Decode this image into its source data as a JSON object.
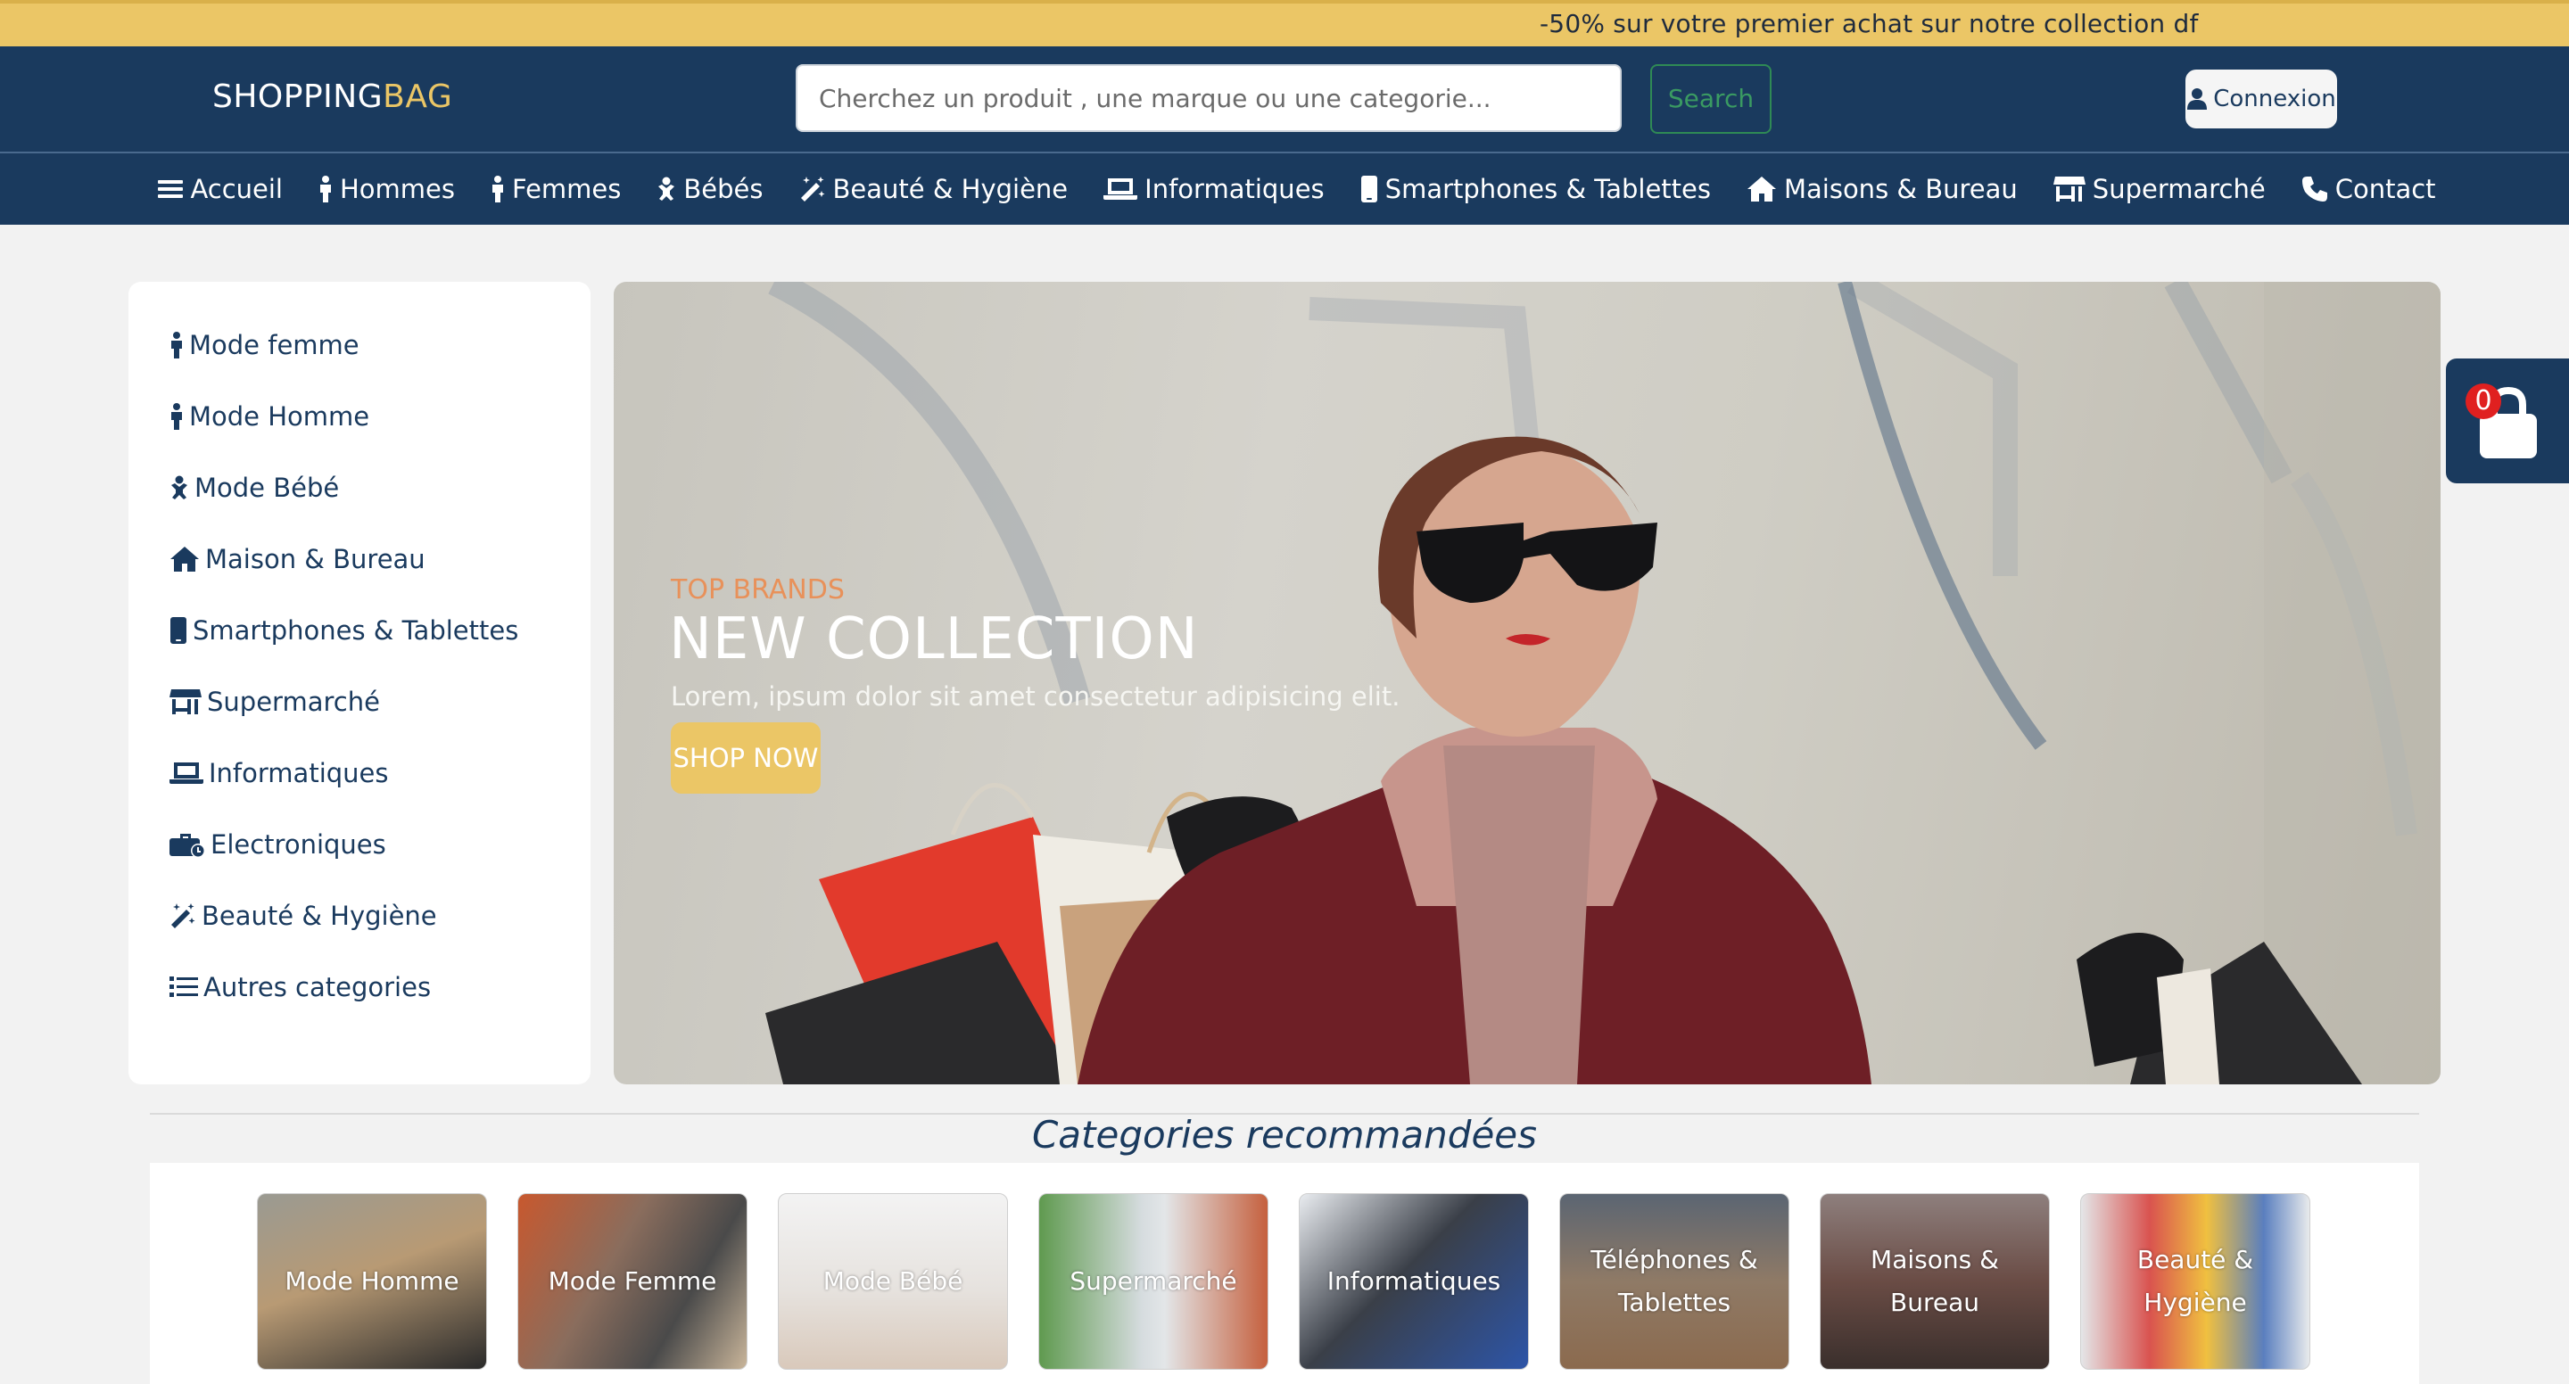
{
  "promo": {
    "text": "-50% sur votre premier achat sur notre collection df"
  },
  "header": {
    "brand_part1": "SHOPPING",
    "brand_part2": "BAG",
    "search_placeholder": "Cherchez un produit , une marque ou une categorie...",
    "search_button": "Search",
    "login_button": "Connexion"
  },
  "nav": {
    "items": [
      {
        "label": "Accueil",
        "icon": "bars-icon"
      },
      {
        "label": "Hommes",
        "icon": "person-icon"
      },
      {
        "label": "Femmes",
        "icon": "person-icon"
      },
      {
        "label": "Bébés",
        "icon": "baby-icon"
      },
      {
        "label": "Beauté & Hygiène",
        "icon": "magic-wand-icon"
      },
      {
        "label": "Informatiques",
        "icon": "laptop-icon"
      },
      {
        "label": "Smartphones & Tablettes",
        "icon": "mobile-icon"
      },
      {
        "label": "Maisons & Bureau",
        "icon": "house-icon"
      },
      {
        "label": "Supermarché",
        "icon": "store-icon"
      },
      {
        "label": "Contact",
        "icon": "phone-icon"
      }
    ]
  },
  "sidebar": {
    "items": [
      {
        "label": "Mode femme",
        "icon": "person-icon"
      },
      {
        "label": "Mode Homme",
        "icon": "person-icon"
      },
      {
        "label": "Mode Bébé",
        "icon": "baby-icon"
      },
      {
        "label": "Maison & Bureau",
        "icon": "house-icon"
      },
      {
        "label": "Smartphones & Tablettes",
        "icon": "mobile-icon"
      },
      {
        "label": "Supermarché",
        "icon": "store-icon"
      },
      {
        "label": "Informatiques",
        "icon": "laptop-icon"
      },
      {
        "label": "Electroniques",
        "icon": "toolbox-icon"
      },
      {
        "label": "Beauté & Hygiène",
        "icon": "magic-wand-icon"
      },
      {
        "label": "Autres categories",
        "icon": "list-icon"
      }
    ]
  },
  "hero": {
    "kicker": "TOP BRANDS",
    "title": "NEW COLLECTION",
    "text": "Lorem, ipsum dolor sit amet consectetur adipisicing elit.",
    "button": "SHOP NOW"
  },
  "cart": {
    "count": "0",
    "icon": "shopping-bag-icon"
  },
  "categories": {
    "title": "Categories recommandées",
    "items": [
      {
        "label": "Mode Homme"
      },
      {
        "label": "Mode Femme"
      },
      {
        "label": "Mode Bébé"
      },
      {
        "label": "Supermarché"
      },
      {
        "label": "Informatiques"
      },
      {
        "label": "Téléphones & Tablettes"
      },
      {
        "label": "Maisons & Bureau"
      },
      {
        "label": "Beauté & Hygiène"
      }
    ]
  },
  "colors": {
    "navy": "#1a3a5e",
    "gold": "#ebc666",
    "orange_text": "#e8915a",
    "green_button": "#2f8a55",
    "badge_red": "#e02020"
  }
}
